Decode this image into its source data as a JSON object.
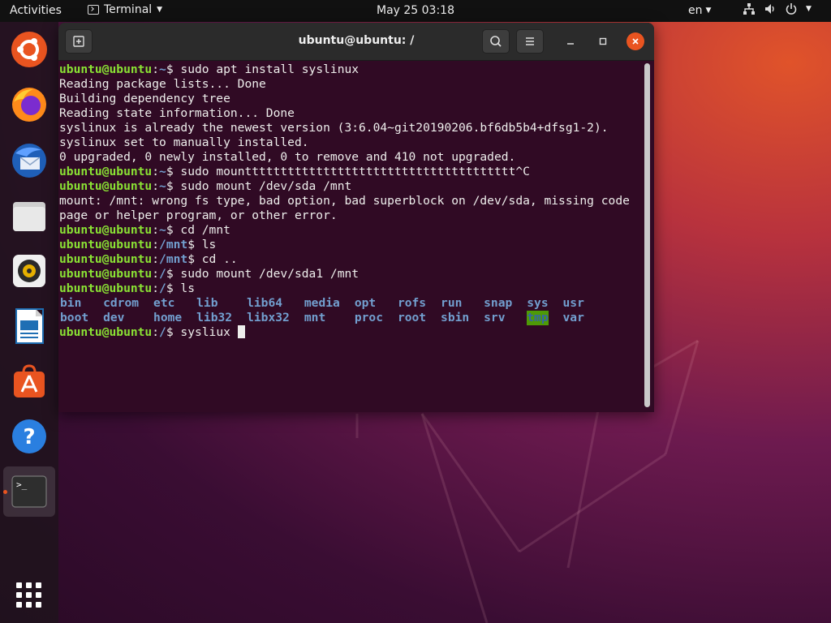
{
  "topbar": {
    "activities": "Activities",
    "app_name": "Terminal",
    "clock": "May 25  03:18",
    "language": "en"
  },
  "dock": {
    "items": [
      "Ubuntu Software Center",
      "Firefox",
      "Thunderbird",
      "Files",
      "Rhythmbox",
      "LibreOffice Writer",
      "Ubuntu Software",
      "Help",
      "Terminal",
      "Show Applications"
    ]
  },
  "window": {
    "title": "ubuntu@ubuntu: /"
  },
  "terminal": {
    "prompt_user": "ubuntu@ubuntu",
    "lines": [
      {
        "type": "prompt",
        "path": "~",
        "cmd": "sudo apt install syslinux"
      },
      {
        "type": "out",
        "text": "Reading package lists... Done"
      },
      {
        "type": "out",
        "text": "Building dependency tree"
      },
      {
        "type": "out",
        "text": "Reading state information... Done"
      },
      {
        "type": "out",
        "text": "syslinux is already the newest version (3:6.04~git20190206.bf6db5b4+dfsg1-2)."
      },
      {
        "type": "out",
        "text": "syslinux set to manually installed."
      },
      {
        "type": "out",
        "text": "0 upgraded, 0 newly installed, 0 to remove and 410 not upgraded."
      },
      {
        "type": "prompt",
        "path": "~",
        "cmd": "sudo mountttttttttttttttttttttttttttttttttttttt^C"
      },
      {
        "type": "prompt",
        "path": "~",
        "cmd": "sudo mount /dev/sda /mnt"
      },
      {
        "type": "out",
        "text": "mount: /mnt: wrong fs type, bad option, bad superblock on /dev/sda, missing code"
      },
      {
        "type": "out",
        "text": "page or helper program, or other error."
      },
      {
        "type": "prompt",
        "path": "~",
        "cmd": "cd /mnt"
      },
      {
        "type": "prompt",
        "path": "/mnt",
        "cmd": "ls"
      },
      {
        "type": "prompt",
        "path": "/mnt",
        "cmd": "cd .."
      },
      {
        "type": "prompt",
        "path": "/",
        "cmd": "sudo mount /dev/sda1 /mnt"
      },
      {
        "type": "prompt",
        "path": "/",
        "cmd": "ls"
      }
    ],
    "ls_row1": [
      "bin",
      "cdrom",
      "etc",
      "lib",
      "lib64",
      "media",
      "opt",
      "rofs",
      "run",
      "snap",
      "sys",
      "usr"
    ],
    "ls_row2": [
      "boot",
      "dev",
      "home",
      "lib32",
      "libx32",
      "mnt",
      "proc",
      "root",
      "sbin",
      "srv",
      "tmp",
      "var"
    ],
    "last_prompt": {
      "path": "/",
      "cmd": "sysliux "
    }
  }
}
